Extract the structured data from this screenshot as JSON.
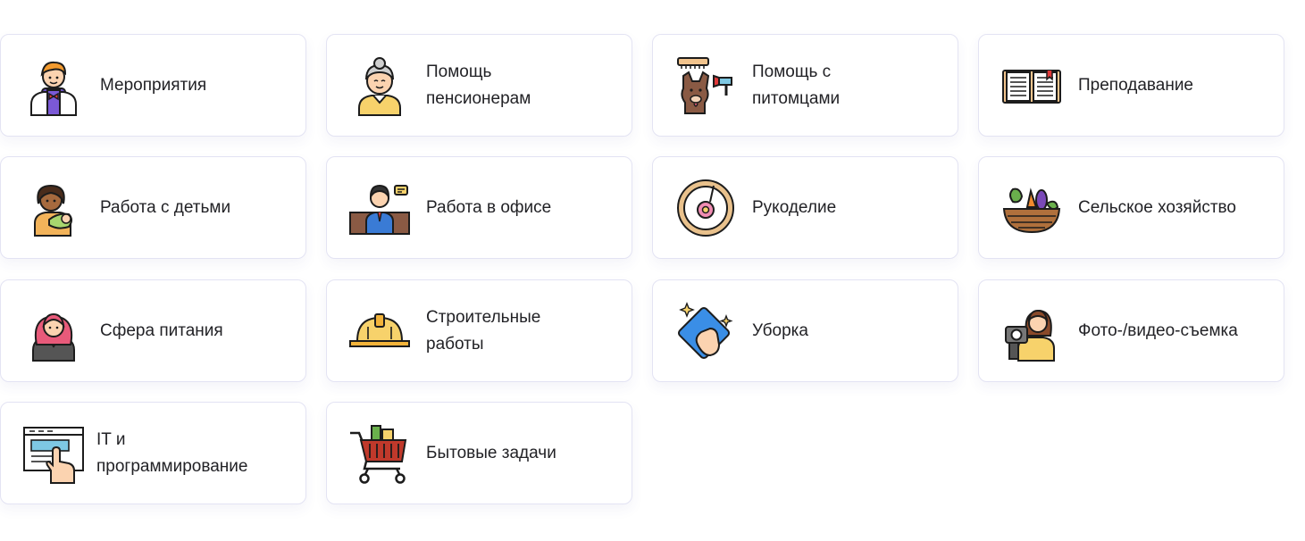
{
  "categories": [
    {
      "label": "Мероприятия",
      "icon": "waiter-icon"
    },
    {
      "label": "Помощь\nпенсионерам",
      "icon": "elderly-woman-icon"
    },
    {
      "label": "Помощь с\nпитомцами",
      "icon": "dog-grooming-icon"
    },
    {
      "label": "Преподавание",
      "icon": "open-book-icon"
    },
    {
      "label": "Работа с детьми",
      "icon": "nanny-with-baby-icon"
    },
    {
      "label": "Работа в офисе",
      "icon": "office-worker-icon"
    },
    {
      "label": "Рукоделие",
      "icon": "embroidery-hoop-icon"
    },
    {
      "label": "Сельское хозяйство",
      "icon": "vegetable-basket-icon"
    },
    {
      "label": "Сфера питания",
      "icon": "waitress-icon"
    },
    {
      "label": "Строительные\nработы",
      "icon": "hard-hat-icon"
    },
    {
      "label": "Уборка",
      "icon": "cleaning-cloth-icon"
    },
    {
      "label": "Фото-/видео-съемка",
      "icon": "videographer-icon"
    },
    {
      "label": "IT и\nпрограммирование",
      "icon": "touch-screen-icon"
    },
    {
      "label": "Бытовые задачи",
      "icon": "shopping-cart-icon"
    }
  ],
  "colors": {
    "border": "#e3e3f3",
    "text": "#222226",
    "outline": "#1c1c1c"
  }
}
